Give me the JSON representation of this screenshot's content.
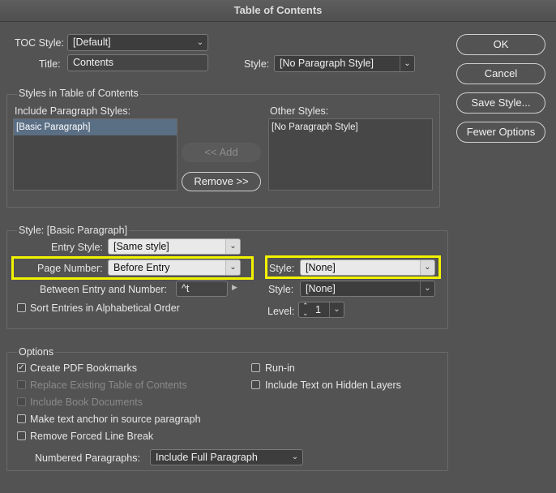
{
  "window": {
    "title": "Table of Contents"
  },
  "buttons": {
    "ok": "OK",
    "cancel": "Cancel",
    "save_style": "Save Style...",
    "fewer_options": "Fewer Options",
    "add": "<< Add",
    "remove": "Remove >>"
  },
  "top": {
    "toc_style_label": "TOC Style:",
    "toc_style_value": "[Default]",
    "title_label": "Title:",
    "title_value": "Contents",
    "style_label": "Style:",
    "style_value": "[No Paragraph Style]"
  },
  "styles_group": {
    "title": "Styles in Table of Contents",
    "include_label": "Include Paragraph Styles:",
    "include_items": [
      "[Basic Paragraph]"
    ],
    "other_label": "Other Styles:",
    "other_items": [
      "[No Paragraph Style]"
    ]
  },
  "style_group": {
    "title": "Style: [Basic Paragraph]",
    "entry_style_label": "Entry Style:",
    "entry_style_value": "[Same style]",
    "page_number_label": "Page Number:",
    "page_number_value": "Before Entry",
    "page_style_label": "Style:",
    "page_style_value": "[None]",
    "between_label": "Between Entry and Number:",
    "between_value": "^t",
    "between_style_label": "Style:",
    "between_style_value": "[None]",
    "sort_label": "Sort Entries in Alphabetical Order",
    "level_label": "Level:",
    "level_value": "1"
  },
  "options": {
    "title": "Options",
    "create_pdf": "Create PDF Bookmarks",
    "replace_existing": "Replace Existing Table of Contents",
    "include_book": "Include Book Documents",
    "make_anchor": "Make text anchor in source paragraph",
    "remove_break": "Remove Forced Line Break",
    "run_in": "Run-in",
    "hidden_layers": "Include Text on Hidden Layers",
    "numbered_label": "Numbered Paragraphs:",
    "numbered_value": "Include Full Paragraph"
  },
  "colors": {
    "highlight": "#f2f200",
    "background": "#535353"
  }
}
